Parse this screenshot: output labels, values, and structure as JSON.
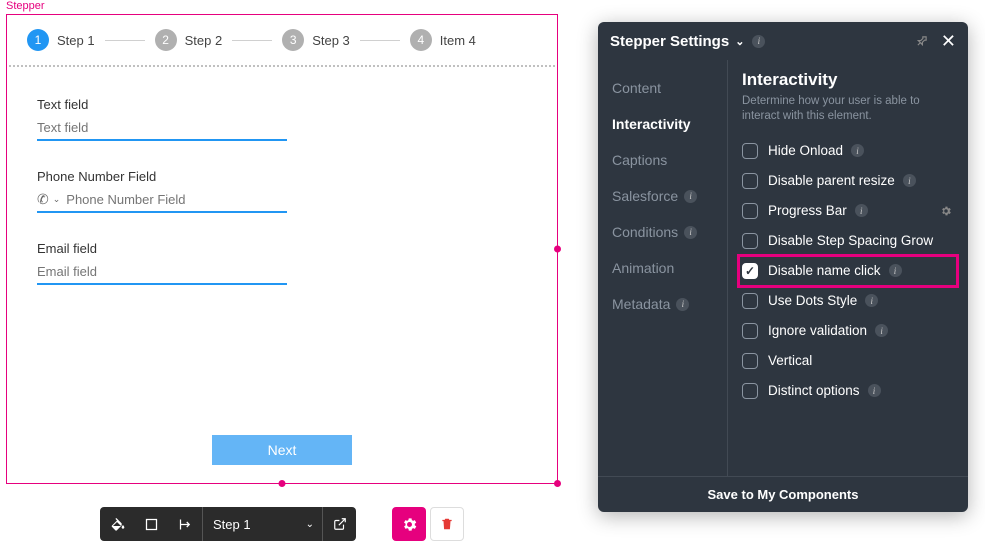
{
  "canvas": {
    "component_label": "Stepper",
    "steps": [
      {
        "num": "1",
        "label": "Step 1",
        "active": true
      },
      {
        "num": "2",
        "label": "Step 2",
        "active": false
      },
      {
        "num": "3",
        "label": "Step 3",
        "active": false
      },
      {
        "num": "4",
        "label": "Item 4",
        "active": false
      }
    ],
    "fields": {
      "text": {
        "label": "Text field",
        "placeholder": "Text field"
      },
      "phone": {
        "label": "Phone Number Field",
        "placeholder": "Phone Number Field"
      },
      "email": {
        "label": "Email field",
        "placeholder": "Email field"
      }
    },
    "next_button": "Next"
  },
  "toolbar": {
    "step_select": "Step 1"
  },
  "settings": {
    "title": "Stepper Settings",
    "nav": {
      "content": "Content",
      "interactivity": "Interactivity",
      "captions": "Captions",
      "salesforce": "Salesforce",
      "conditions": "Conditions",
      "animation": "Animation",
      "metadata": "Metadata"
    },
    "section_title": "Interactivity",
    "section_desc": "Determine how your user is able to interact with this element.",
    "options": {
      "hide_onload": {
        "label": "Hide Onload",
        "checked": false,
        "info": true
      },
      "disable_resize": {
        "label": "Disable parent resize",
        "checked": false,
        "info": true
      },
      "progress_bar": {
        "label": "Progress Bar",
        "checked": false,
        "info": true,
        "gear": true
      },
      "disable_grow": {
        "label": "Disable Step Spacing Grow",
        "checked": false,
        "info": false
      },
      "disable_name": {
        "label": "Disable name click",
        "checked": true,
        "info": true,
        "highlight": true
      },
      "dots_style": {
        "label": "Use Dots Style",
        "checked": false,
        "info": true
      },
      "ignore_valid": {
        "label": "Ignore validation",
        "checked": false,
        "info": true
      },
      "vertical": {
        "label": "Vertical",
        "checked": false,
        "info": false
      },
      "distinct": {
        "label": "Distinct options",
        "checked": false,
        "info": true
      }
    },
    "footer": "Save to My Components"
  }
}
